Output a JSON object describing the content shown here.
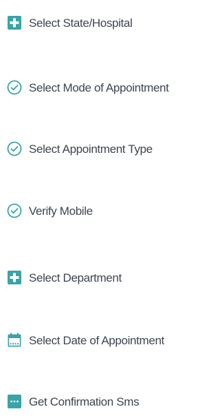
{
  "steps": [
    {
      "label": "Select State/Hospital",
      "icon": "hospital-plus-icon"
    },
    {
      "label": "Select Mode of Appointment",
      "icon": "check-circle-icon"
    },
    {
      "label": "Select Appointment Type",
      "icon": "check-circle-icon"
    },
    {
      "label": "Verify Mobile",
      "icon": "check-circle-icon"
    },
    {
      "label": "Select Department",
      "icon": "hospital-plus-icon"
    },
    {
      "label": "Select Date of Appointment",
      "icon": "calendar-icon"
    },
    {
      "label": "Get Confirmation Sms",
      "icon": "sms-icon"
    }
  ],
  "colors": {
    "accent": "#3aa3a7",
    "text": "#3d4550"
  }
}
